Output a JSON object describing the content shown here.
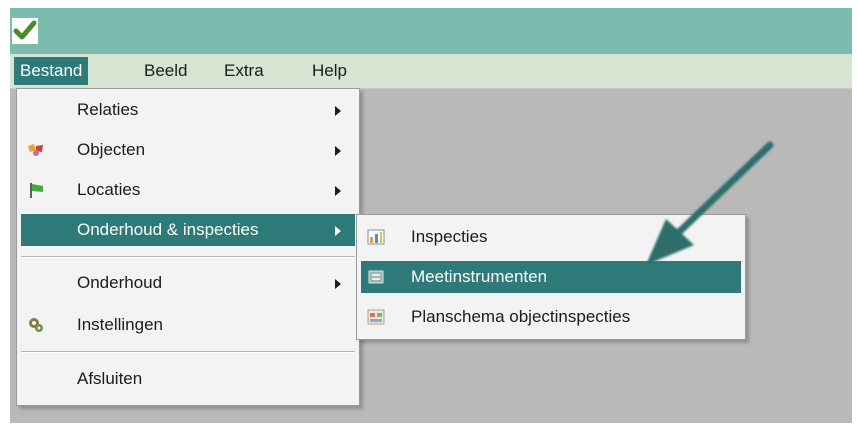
{
  "app": {
    "icon": "checkmark-icon"
  },
  "menubar": {
    "items": [
      {
        "label": "Bestand",
        "active": true
      },
      {
        "label": "Beeld",
        "active": false
      },
      {
        "label": "Extra",
        "active": false
      },
      {
        "label": "Help",
        "active": false
      }
    ]
  },
  "bestand_menu": {
    "items": [
      {
        "label": "Relaties",
        "icon": null,
        "submenu": true
      },
      {
        "label": "Objecten",
        "icon": "objects-icon",
        "submenu": true
      },
      {
        "label": "Locaties",
        "icon": "location-flag-icon",
        "submenu": true
      },
      {
        "label": "Onderhoud & inspecties",
        "icon": null,
        "submenu": true,
        "highlighted": true
      },
      {
        "label": "Onderhoud",
        "icon": null,
        "submenu": true
      },
      {
        "label": "Instellingen",
        "icon": "settings-gears-icon",
        "submenu": false
      },
      {
        "label": "Afsluiten",
        "icon": null,
        "submenu": false
      }
    ]
  },
  "submenu": {
    "items": [
      {
        "label": "Inspecties",
        "icon": "inspection-report-icon"
      },
      {
        "label": "Meetinstrumenten",
        "icon": "measuring-instrument-icon",
        "highlighted": true
      },
      {
        "label": "Planschema objectinspecties",
        "icon": "schedule-icon"
      }
    ]
  },
  "colors": {
    "titlebar": "#7cbcae",
    "menubar": "#d6e4d2",
    "highlight": "#2d7a78",
    "workspace": "#b9b9b9",
    "annotation_arrow": "#2f6e6b"
  }
}
